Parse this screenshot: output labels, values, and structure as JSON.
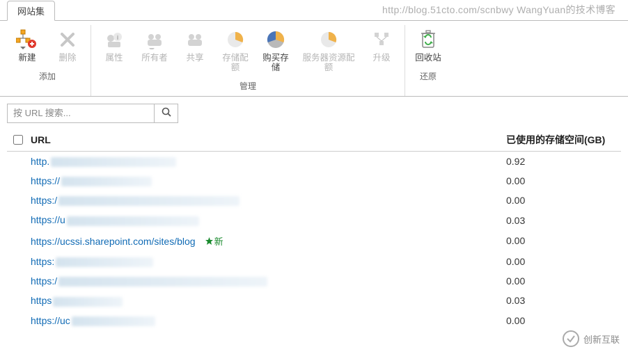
{
  "watermark": "http://blog.51cto.com/scnbwy WangYuan的技术博客",
  "tab": {
    "label": "网站集"
  },
  "ribbon": {
    "groups": {
      "add": {
        "label": "添加",
        "new": "新建",
        "delete": "删除"
      },
      "manage": {
        "label": "管理",
        "properties": "属性",
        "owners": "所有者",
        "share": "共享",
        "storage_quota": "存储配额",
        "purchase_storage": "购买存储",
        "server_resource_quota": "服务器资源配额",
        "upgrade": "升级"
      },
      "restore": {
        "label": "还原",
        "recycle_bin": "回收站"
      }
    }
  },
  "search": {
    "placeholder": "按 URL 搜索..."
  },
  "columns": {
    "url": "URL",
    "storage": "已使用的存储空间(GB)"
  },
  "rows": [
    {
      "url_prefix": "http.",
      "blur_width": 180,
      "storage": "0.92",
      "new": false
    },
    {
      "url_prefix": "https://",
      "blur_width": 130,
      "storage": "0.00",
      "new": false
    },
    {
      "url_prefix": "https:/",
      "blur_width": 260,
      "storage": "0.00",
      "new": false
    },
    {
      "url_prefix": "https://u",
      "blur_width": 190,
      "storage": "0.03",
      "new": false
    },
    {
      "url_prefix": "https://ucssi.sharepoint.com/sites/blog",
      "blur_width": 0,
      "storage": "0.00",
      "new": true
    },
    {
      "url_prefix": "https:",
      "blur_width": 140,
      "storage": "0.00",
      "new": false
    },
    {
      "url_prefix": "https:/",
      "blur_width": 300,
      "storage": "0.00",
      "new": false
    },
    {
      "url_prefix": "https",
      "blur_width": 100,
      "storage": "0.03",
      "new": false
    },
    {
      "url_prefix": "https://uc",
      "blur_width": 120,
      "storage": "0.00",
      "new": false
    }
  ],
  "new_label": "新",
  "footer_logo": "创新互联"
}
